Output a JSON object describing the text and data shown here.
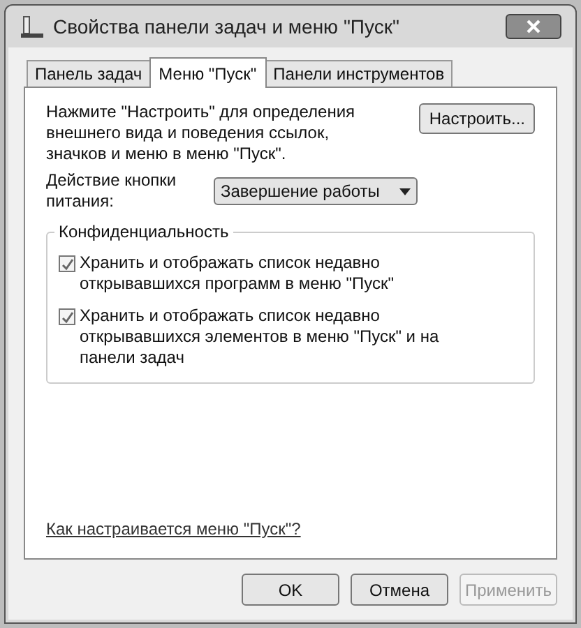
{
  "window": {
    "title": "Свойства панели задач и меню \"Пуск\""
  },
  "tabs": [
    {
      "label": "Панель задач",
      "selected": false
    },
    {
      "label": "Меню \"Пуск\"",
      "selected": true
    },
    {
      "label": "Панели инструментов",
      "selected": false
    }
  ],
  "description": "Нажмите \"Настроить\" для определения внешнего вида и поведения ссылок, значков и меню в меню \"Пуск\".",
  "customize_button": "Настроить...",
  "power_button": {
    "label": "Действие кнопки питания:",
    "value": "Завершение работы"
  },
  "privacy": {
    "title": "Конфиденциальность",
    "options": [
      {
        "label": "Хранить и отображать список недавно открывавшихся программ в меню \"Пуск\"",
        "checked": true
      },
      {
        "label": "Хранить и отображать список недавно открывавшихся элементов в меню \"Пуск\" и на панели задач",
        "checked": true
      }
    ]
  },
  "help_link": "Как настраивается меню \"Пуск\"?",
  "buttons": [
    {
      "label": "OK",
      "disabled": false
    },
    {
      "label": "Отмена",
      "disabled": false
    },
    {
      "label": "Применить",
      "disabled": true
    }
  ]
}
